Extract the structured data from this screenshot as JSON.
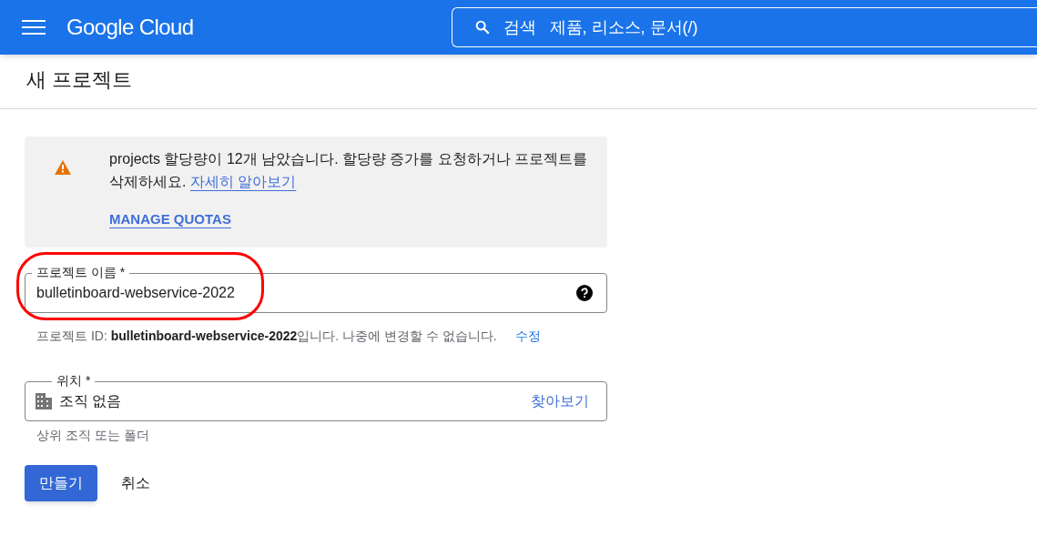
{
  "header": {
    "logo": "Google Cloud",
    "search_label": "검색",
    "search_placeholder": "제품, 리소스, 문서(/)"
  },
  "page_title": "새 프로젝트",
  "notice": {
    "message": "projects 할당량이 12개 남았습니다. 할당량 증가를 요청하거나 프로젝트를 삭제하세요.",
    "link": "자세히 알아보기",
    "action": "MANAGE QUOTAS"
  },
  "name_field": {
    "label": "프로젝트 이름 *",
    "value": "bulletinboard-webservice-2022",
    "circled": true,
    "helper": "프로젝트 ID: **bulletinboard-webservice-2022**입니다. 나중에 변경할 수 없습니다.",
    "helper_action": "수정"
  },
  "location_field": {
    "label": "위치 *",
    "value": "조직 없음",
    "action": "찾아보기",
    "helper": "상위 조직 또는 폴더"
  },
  "buttons": [
    {
      "label": "만들기",
      "kind": "primary"
    },
    {
      "label": "취소",
      "kind": "text"
    }
  ]
}
